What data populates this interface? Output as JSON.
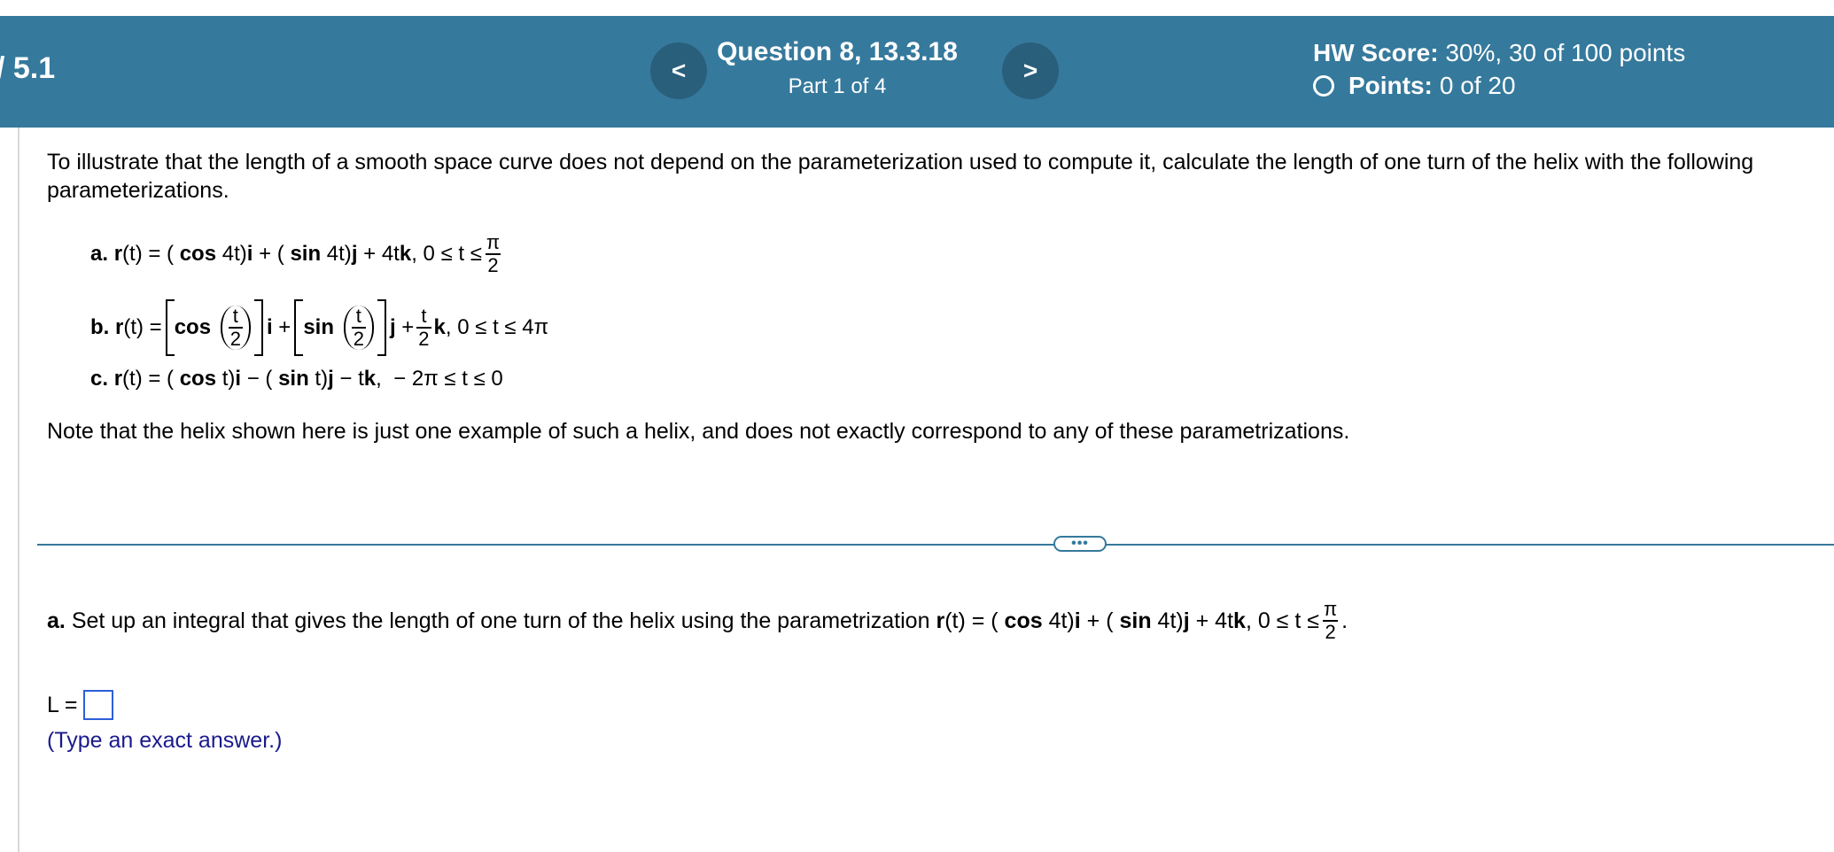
{
  "header": {
    "section_label": "/ 5.1",
    "prev_label": "<",
    "next_label": ">",
    "question_title": "Question 8, 13.3.18",
    "question_part": "Part 1 of 4",
    "hw_score_label": "HW Score:",
    "hw_score_value": "30%, 30 of 100 points",
    "points_label": "Points:",
    "points_value": "0 of 20"
  },
  "problem": {
    "intro": "To illustrate that the length of a smooth space curve does not depend on the parameterization used to compute it, calculate the length of one turn of the helix with the following parameterizations.",
    "a_label": "a.",
    "b_label": "b.",
    "c_label": "c.",
    "note": "Note that the helix shown here is just one example of such a helix, and does not exactly correspond to any of these parametrizations."
  },
  "question": {
    "label": "a.",
    "text": "Set up an integral that gives the length of one turn of the helix using the parametrization",
    "answer_label": "L =",
    "answer_value": "",
    "hint": "(Type an exact answer.)"
  },
  "colors": {
    "header_bg": "#35799c",
    "nav_btn_bg": "#2a5f7c",
    "hint_text": "#1a1a8c",
    "answer_border": "#2d5fd8"
  },
  "icons": {
    "prev": "chevron-left-icon",
    "next": "chevron-right-icon",
    "points": "circle-outline-icon",
    "ellipsis": "ellipsis-icon"
  }
}
